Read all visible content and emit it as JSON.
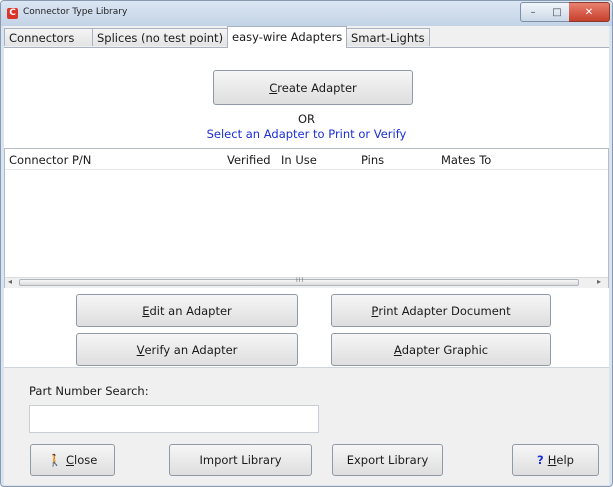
{
  "window": {
    "title": "Connector Type Library",
    "app_icon_letter": "C",
    "controls": {
      "minimize": "–",
      "maximize": "□",
      "close": "✕"
    }
  },
  "tabs": [
    {
      "label": "Connectors",
      "active": false
    },
    {
      "label": "Splices (no test point)",
      "active": false
    },
    {
      "label": "easy-wire Adapters",
      "active": true
    },
    {
      "label": "Smart-Lights",
      "active": false
    }
  ],
  "create": {
    "mnemonic": "C",
    "rest": "reate Adapter"
  },
  "or_text": "OR",
  "select_prompt": "Select an Adapter to Print or Verify",
  "list": {
    "columns": [
      "Connector P/N",
      "Verified",
      "In Use",
      "Pins",
      "Mates To"
    ],
    "rows": [],
    "scroll_left": "◂",
    "scroll_right": "▸",
    "scroll_grip": "III"
  },
  "actions": {
    "edit": {
      "mnemonic": "E",
      "rest": "dit an Adapter"
    },
    "print": {
      "mnemonic": "P",
      "rest": "rint Adapter Document"
    },
    "verify": {
      "mnemonic": "V",
      "rest": "erify an Adapter"
    },
    "graphic": {
      "mnemonic": "A",
      "rest": "dapter Graphic"
    }
  },
  "search": {
    "label": "Part Number Search:",
    "value": "",
    "placeholder": ""
  },
  "footer": {
    "close": {
      "mnemonic": "C",
      "rest": "lose",
      "icon": "figure-icon",
      "icon_glyph": "🚶",
      "icon_color": "#c8a000"
    },
    "import": "Import Library",
    "export": "Export Library",
    "help": {
      "glyph": "?",
      "mnemonic": "H",
      "rest": "elp",
      "icon_color": "#1a2fd6"
    }
  }
}
